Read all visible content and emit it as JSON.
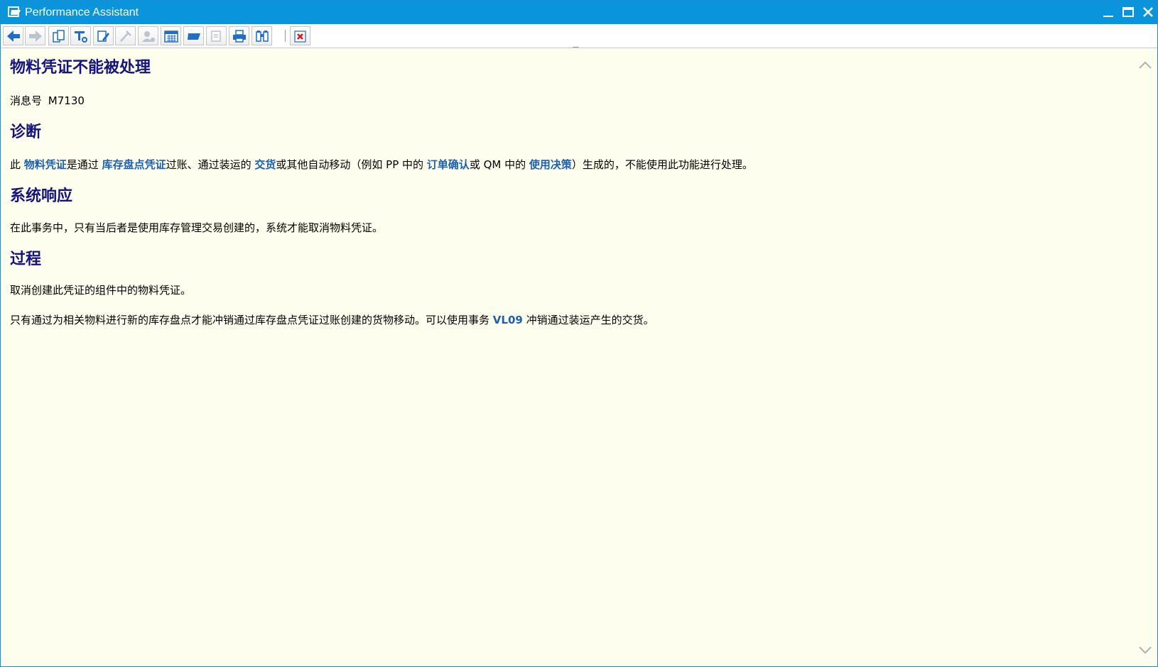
{
  "window": {
    "title": "Performance Assistant",
    "minimize_label": "—",
    "maximize_label": "□",
    "close_label": "✕"
  },
  "toolbar": {
    "buttons": [
      {
        "name": "back-button",
        "icon": "arrow-left-icon"
      },
      {
        "name": "forward-button",
        "icon": "arrow-right-icon"
      },
      {
        "name": "document-button",
        "icon": "document-icon"
      },
      {
        "name": "technical-info-button",
        "icon": "tools-icon"
      },
      {
        "name": "edit-button",
        "icon": "edit-icon"
      },
      {
        "name": "tool-button",
        "icon": "wrench-icon"
      },
      {
        "name": "user-button",
        "icon": "user-icon"
      },
      {
        "name": "calendar-button",
        "icon": "calendar-icon"
      },
      {
        "name": "flag-button",
        "icon": "flag-icon"
      },
      {
        "name": "preview-button",
        "icon": "preview-icon"
      },
      {
        "name": "print-button",
        "icon": "printer-icon"
      },
      {
        "name": "find-button",
        "icon": "binoculars-icon"
      },
      {
        "name": "close-doc-button",
        "icon": "close-icon"
      }
    ],
    "grip": "....."
  },
  "doc": {
    "title": "物料凭证不能被处理",
    "message_label": "消息号",
    "message_no": "M7130",
    "diagnosis": {
      "heading": "诊断",
      "t1": "此 ",
      "l1": "物料凭证",
      "t2": "是通过 ",
      "l2": "库存盘点凭证",
      "t3": "过账、通过装运的 ",
      "l3": "交货",
      "t4": "或其他自动移动（例如 PP 中的 ",
      "l4": "订单确认",
      "t5": "或 QM 中的 ",
      "l5": "使用决策",
      "t6": "）生成的，不能使用此功能进行处理。"
    },
    "system_response": {
      "heading": "系统响应",
      "text": "在此事务中，只有当后者是使用库存管理交易创建的，系统才能取消物料凭证。"
    },
    "procedure": {
      "heading": "过程",
      "text1": "取消创建此凭证的组件中的物料凭证。",
      "t1": "只有通过为相关物料进行新的库存盘点才能冲销通过库存盘点凭证过账创建的货物移动。可以使用事务 ",
      "l1": "VL09",
      "t2": " 冲销通过装运产生的交货。"
    }
  },
  "colors": {
    "titlebar": "#0a94dc",
    "content_bg": "#fefeef",
    "heading": "#15147f",
    "link": "#1c5fb3"
  }
}
